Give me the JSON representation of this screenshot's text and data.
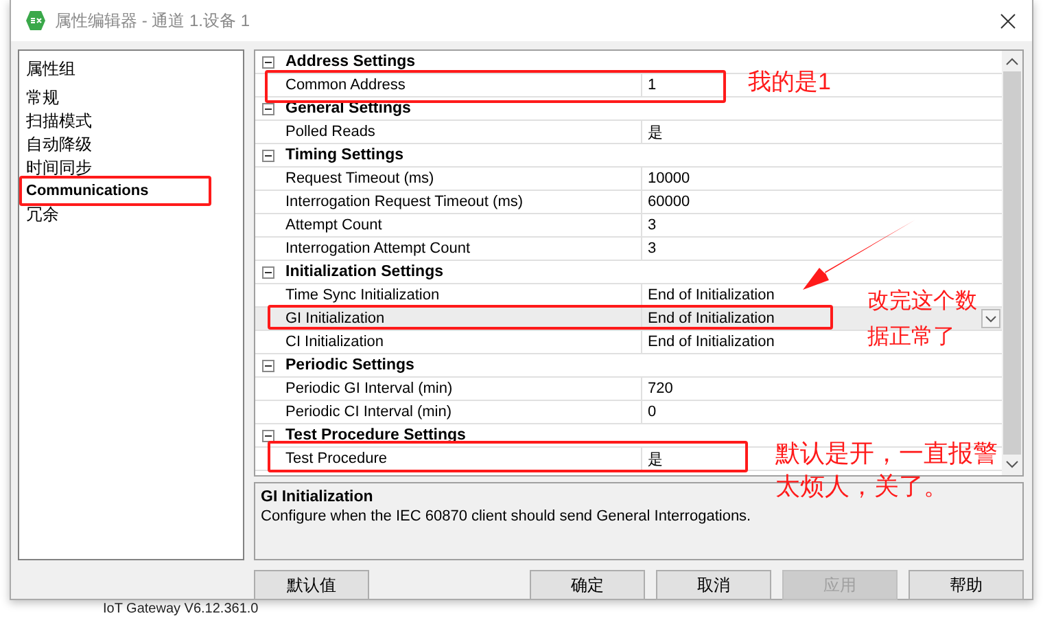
{
  "window": {
    "title": "属性编辑器 - 通道 1.设备 1"
  },
  "property_groups": {
    "header": "属性组",
    "items": [
      {
        "label": "常规",
        "selected": false
      },
      {
        "label": "扫描模式",
        "selected": false
      },
      {
        "label": "自动降级",
        "selected": false
      },
      {
        "label": "时间同步",
        "selected": false
      },
      {
        "label": "Communications",
        "selected": true
      },
      {
        "label": "冗余",
        "selected": false
      }
    ]
  },
  "grid": {
    "sections": [
      {
        "title": "Address Settings",
        "expanded": true,
        "rows": [
          {
            "name": "Common Address",
            "value": "1",
            "selected": false
          }
        ]
      },
      {
        "title": "General Settings",
        "expanded": true,
        "rows": [
          {
            "name": "Polled Reads",
            "value": "是",
            "selected": false
          }
        ]
      },
      {
        "title": "Timing Settings",
        "expanded": true,
        "rows": [
          {
            "name": "Request Timeout (ms)",
            "value": "10000",
            "selected": false
          },
          {
            "name": "Interrogation Request Timeout (ms)",
            "value": "60000",
            "selected": false
          },
          {
            "name": "Attempt Count",
            "value": "3",
            "selected": false
          },
          {
            "name": "Interrogation Attempt Count",
            "value": "3",
            "selected": false
          }
        ]
      },
      {
        "title": "Initialization Settings",
        "expanded": true,
        "rows": [
          {
            "name": "Time Sync Initialization",
            "value": "End of Initialization",
            "selected": false
          },
          {
            "name": "GI Initialization",
            "value": "End of Initialization",
            "selected": true
          },
          {
            "name": "CI Initialization",
            "value": "End of Initialization",
            "selected": false
          }
        ]
      },
      {
        "title": "Periodic Settings",
        "expanded": true,
        "rows": [
          {
            "name": "Periodic GI Interval (min)",
            "value": "720",
            "selected": false
          },
          {
            "name": "Periodic CI Interval (min)",
            "value": "0",
            "selected": false
          }
        ]
      },
      {
        "title": "Test Procedure Settings",
        "expanded": true,
        "rows": [
          {
            "name": "Test Procedure",
            "value": "是",
            "selected": false
          }
        ]
      }
    ]
  },
  "description": {
    "title": "GI Initialization",
    "text": "Configure when the IEC 60870 client should send General Interrogations."
  },
  "buttons": [
    {
      "label": "默认值",
      "disabled": false
    },
    {
      "label": "确定",
      "disabled": false
    },
    {
      "label": "取消",
      "disabled": false
    },
    {
      "label": "应用",
      "disabled": true
    },
    {
      "label": "帮助",
      "disabled": false
    }
  ],
  "background_text": "IoT Gateway V6.12.361.0",
  "annotations": [
    "我的是1",
    "改完这个数据正常了",
    "默认是开，一直报警太烦人，关了。"
  ]
}
